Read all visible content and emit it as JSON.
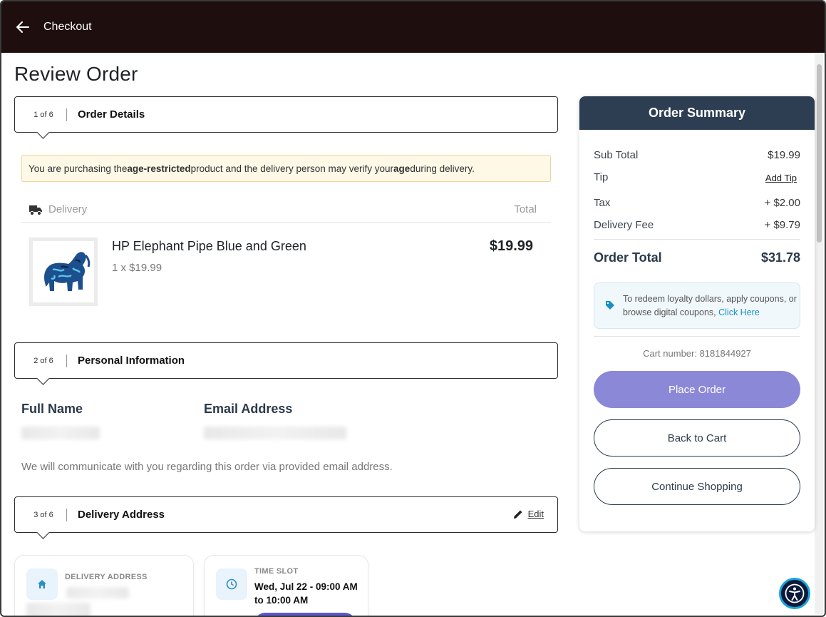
{
  "header": {
    "back_icon": "arrow-left-icon",
    "title": "Checkout"
  },
  "page": {
    "title": "Review Order"
  },
  "sections": {
    "order_details": {
      "step": "1 of 6",
      "title": "Order Details"
    },
    "personal_info": {
      "step": "2 of 6",
      "title": "Personal Information"
    },
    "delivery_address": {
      "step": "3 of 6",
      "title": "Delivery Address",
      "edit_label": "Edit"
    }
  },
  "age_notice": {
    "part1": "You are purchasing the ",
    "bold1": "age-restricted",
    "part2": " product and the delivery person may verify your ",
    "bold2": "age",
    "part3": " during delivery."
  },
  "delivery_table": {
    "delivery_label": "Delivery",
    "total_label": "Total"
  },
  "product": {
    "name": "HP Elephant Pipe Blue and Green",
    "qty_price": "1 x $19.99",
    "price": "$19.99"
  },
  "personal": {
    "full_name_label": "Full Name",
    "email_label": "Email Address",
    "note": "We will communicate with you regarding this order via provided email address."
  },
  "address_cards": {
    "delivery_label": "DELIVERY ADDRESS",
    "time_slot_label": "TIME SLOT",
    "time_slot_value": "Wed, Jul 22 - 09:00 AM to 10:00 AM"
  },
  "summary": {
    "title": "Order Summary",
    "sub_total_label": "Sub Total",
    "sub_total": "$19.99",
    "tip_label": "Tip",
    "add_tip": "Add Tip",
    "tax_label": "Tax",
    "tax": "+ $2.00",
    "delivery_fee_label": "Delivery Fee",
    "delivery_fee": "+ $9.79",
    "order_total_label": "Order Total",
    "order_total": "$31.78",
    "loyalty_text": "To redeem loyalty dollars, apply coupons, or browse digital coupons,",
    "loyalty_link": "Click Here",
    "cart_number": "Cart number: 8181844927",
    "place_order": "Place Order",
    "back_to_cart": "Back to Cart",
    "continue_shopping": "Continue Shopping"
  },
  "colors": {
    "header_bg": "#1e0e0e",
    "summary_head": "#2d3e53",
    "place_order_bg": "#8c88d8",
    "link_blue": "#1a8fc2"
  }
}
